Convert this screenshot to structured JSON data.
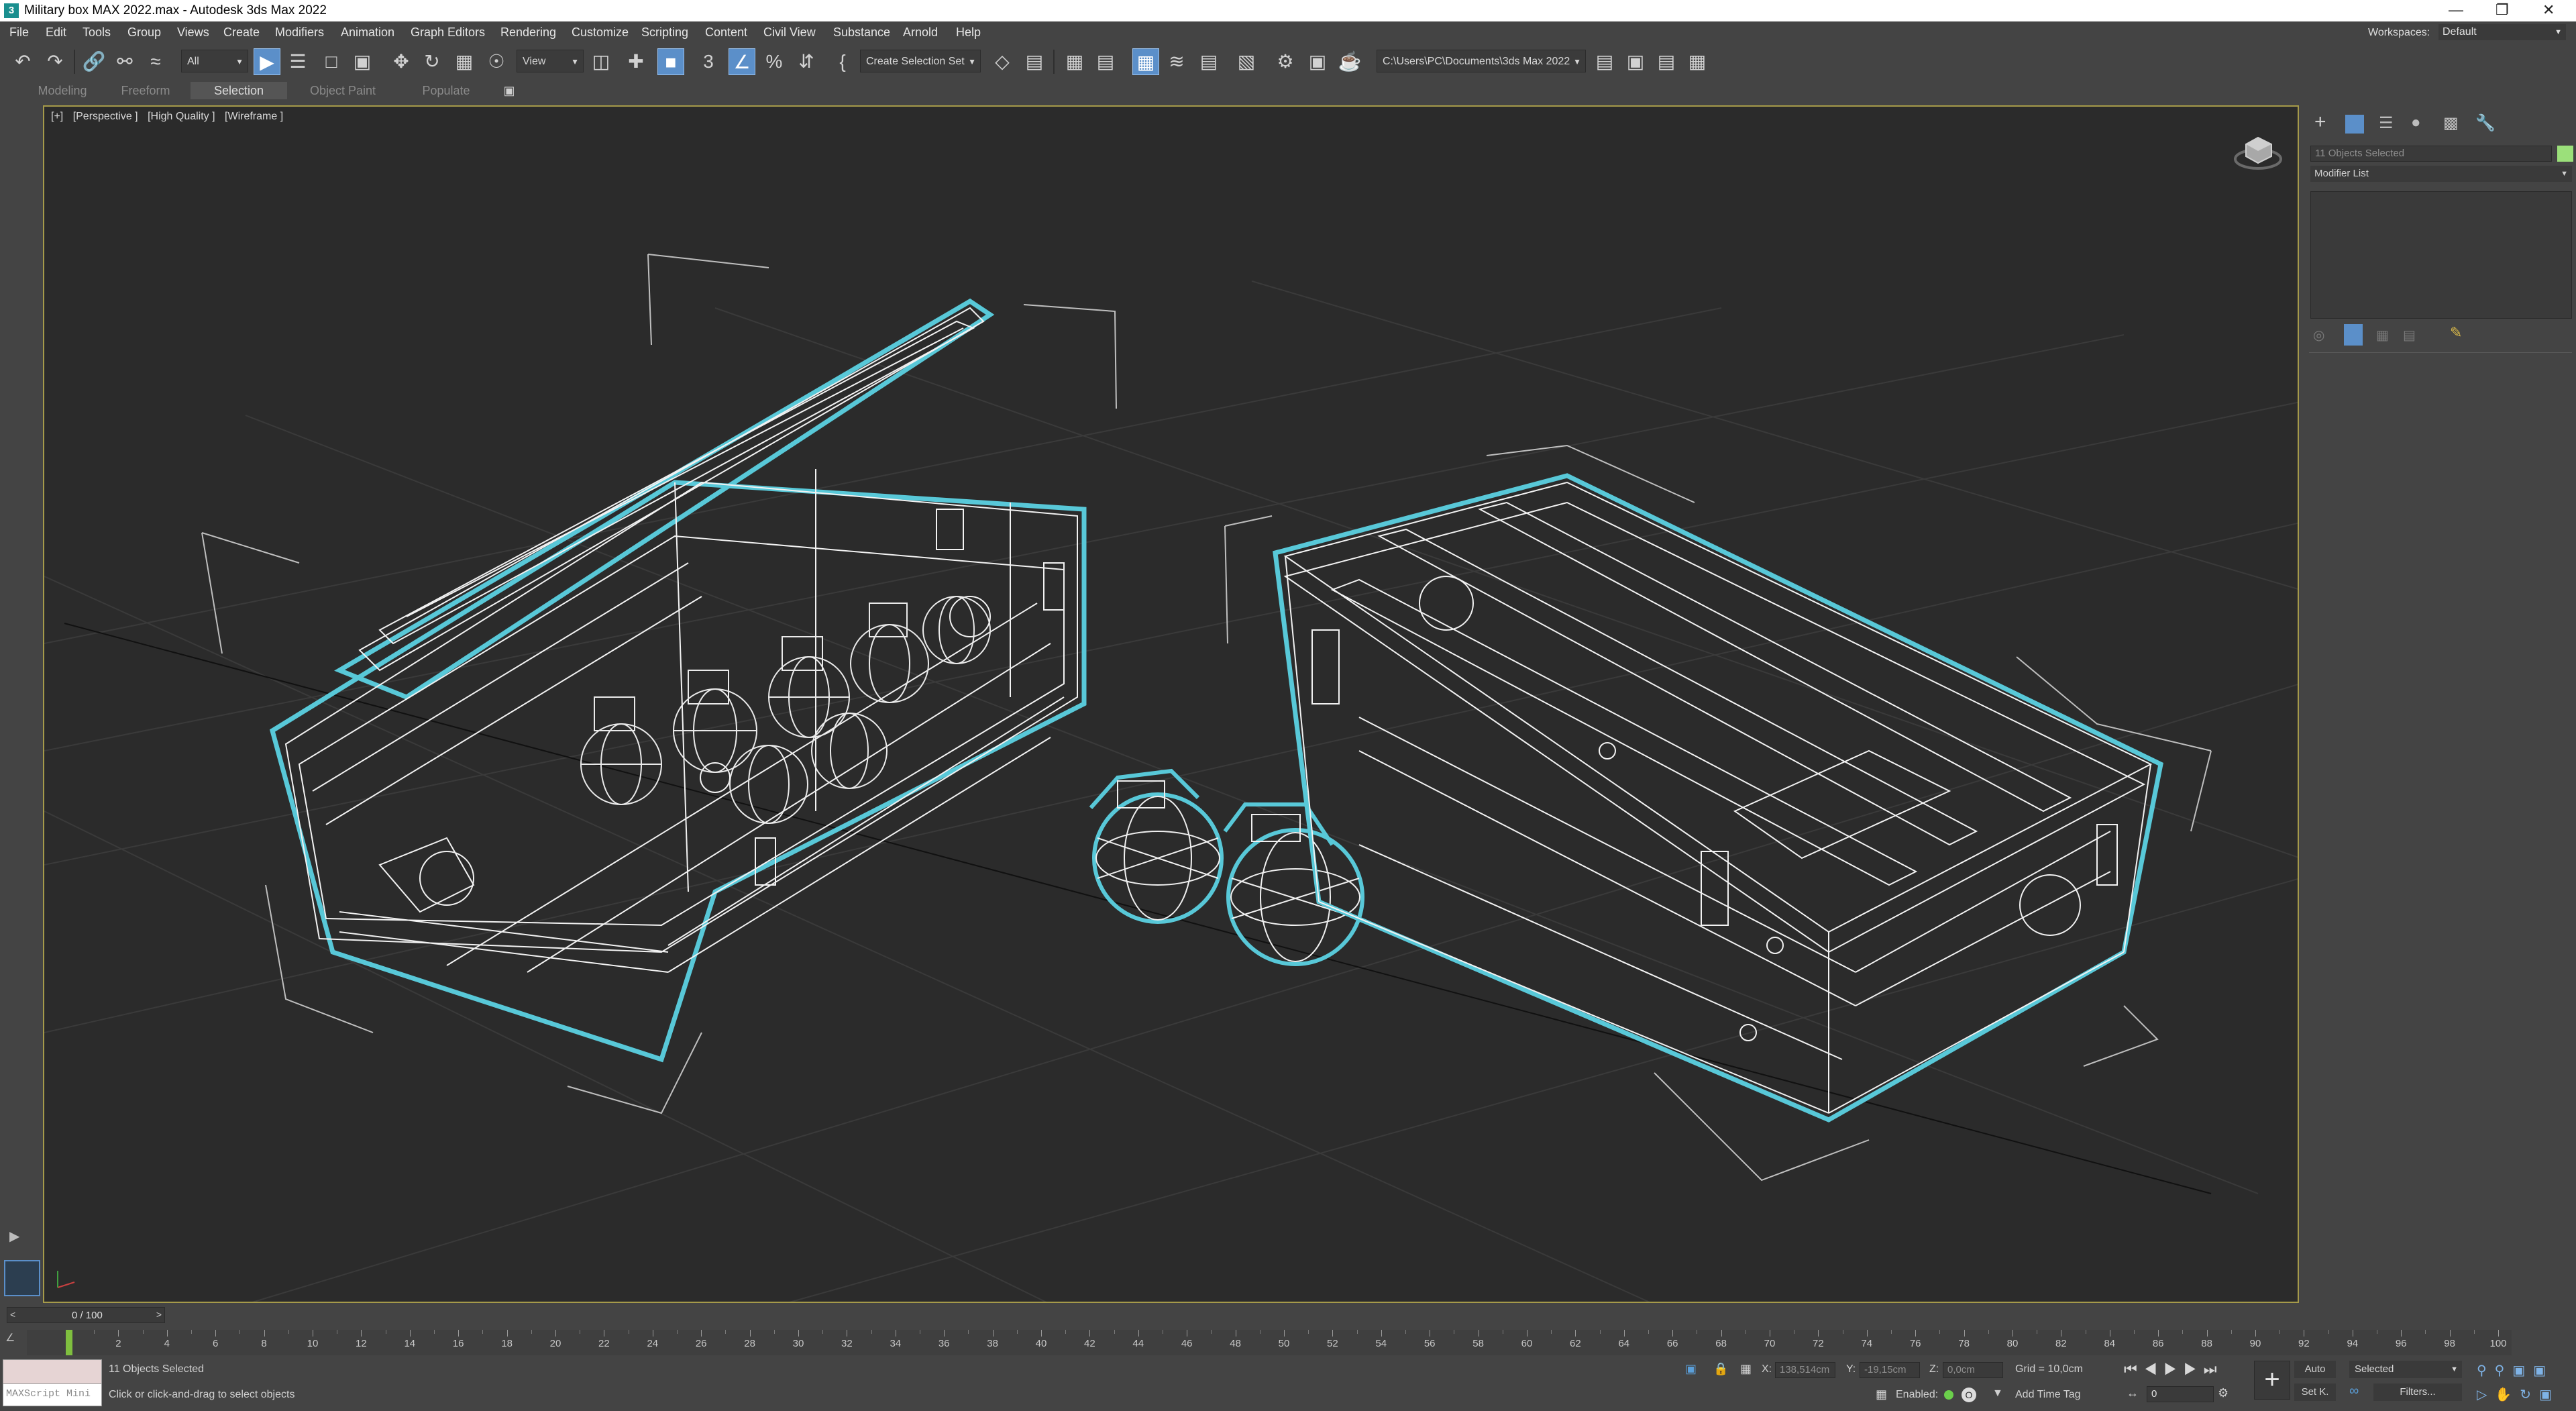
{
  "window": {
    "title": "Military box MAX 2022.max - Autodesk 3ds Max 2022",
    "app_icon": "3",
    "controls": [
      "minimize-icon",
      "restore-icon",
      "close-icon"
    ]
  },
  "menu": [
    "File",
    "Edit",
    "Tools",
    "Group",
    "Views",
    "Create",
    "Modifiers",
    "Animation",
    "Graph Editors",
    "Rendering",
    "Customize",
    "Scripting",
    "Content",
    "Civil View",
    "Substance",
    "Arnold",
    "Help"
  ],
  "workspaces": {
    "label": "Workspaces:",
    "value": "Default"
  },
  "toolbar": {
    "filter_value": "All",
    "view_value": "View",
    "selection_set_value": "Create Selection Set",
    "path_value": "C:\\Users\\PC\\Documents\\3ds Max 2022",
    "snap_label": "3"
  },
  "ribbon_tabs": [
    {
      "label": "Modeling",
      "active": false
    },
    {
      "label": "Freeform",
      "active": false
    },
    {
      "label": "Selection",
      "active": true
    },
    {
      "label": "Object Paint",
      "active": false
    },
    {
      "label": "Populate",
      "active": false
    }
  ],
  "viewport": {
    "labels": [
      "[+]",
      "[Perspective ]",
      "[High Quality ]",
      "[Wireframe ]"
    ],
    "selection_color": "#58c8d8",
    "wire_color": "#f2f2f2",
    "grid_color": "#3a3a3a"
  },
  "command_panel": {
    "selected_text": "11 Objects Selected",
    "modifier_list": "Modifier List",
    "object_color": "#9be07a"
  },
  "timeline": {
    "frame_display": "0 / 100",
    "ticks": [
      "0",
      "2",
      "4",
      "6",
      "8",
      "10",
      "12",
      "14",
      "16",
      "18",
      "20",
      "22",
      "24",
      "26",
      "28",
      "30",
      "32",
      "34",
      "36",
      "38",
      "40",
      "42",
      "44",
      "46",
      "48",
      "50",
      "52",
      "54",
      "56",
      "58",
      "60",
      "62",
      "64",
      "66",
      "68",
      "70",
      "72",
      "74",
      "76",
      "78",
      "80",
      "82",
      "84",
      "86",
      "88",
      "90",
      "92",
      "94",
      "96",
      "98",
      "100"
    ]
  },
  "status": {
    "maxscript": "MAXScript Mini",
    "selection": "11 Objects Selected",
    "prompt": "Click or click-and-drag to select objects",
    "x_label": "X:",
    "x_value": "138,514cm",
    "y_label": "Y:",
    "y_value": "-19,15cm",
    "z_label": "Z:",
    "z_value": "0,0cm",
    "grid": "Grid = 10,0cm",
    "enabled_label": "Enabled:",
    "add_time_tag": "Add Time Tag",
    "auto_label": "Auto",
    "set_key_label": "Set K.",
    "selected_value": "Selected",
    "frame_value": "0",
    "filters_label": "Filters..."
  }
}
